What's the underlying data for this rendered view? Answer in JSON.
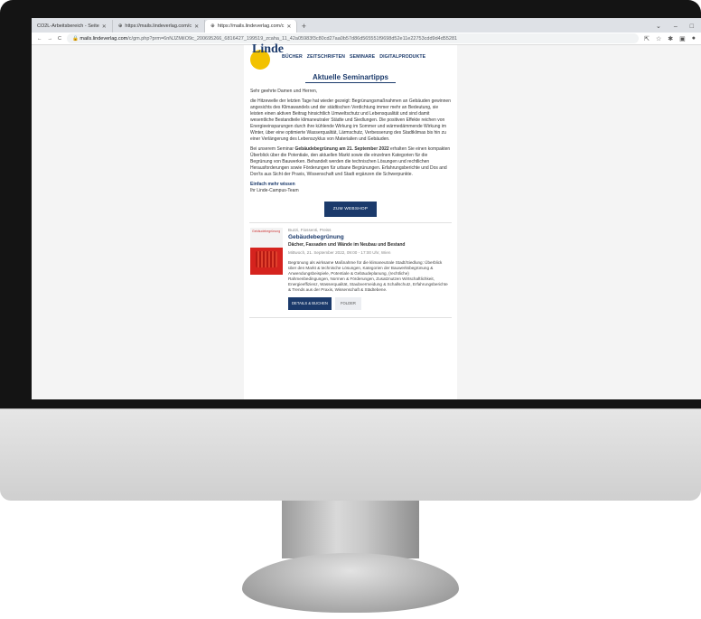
{
  "browser": {
    "tabs": [
      {
        "label": "CO2L-Arbeitsbereich - Seite",
        "active": false
      },
      {
        "label": "https://mails.lindeverlag.com/c",
        "active": false
      },
      {
        "label": "https://mails.lindeverlag.com/c",
        "active": true
      }
    ],
    "url_host": "mails.lindeverlag.com",
    "url_rest": "/c/gm.php?prm=6nNJZMiIO9c_200695266_6816427_199519_zcaha_11_42a05983f3c80cd27aa0b57d86d565551f9698d52e11e22753cdd9d4d55281",
    "new_tab": "+",
    "tab_close": "✕"
  },
  "email": {
    "logo": "Linde",
    "nav": [
      "BÜCHER",
      "ZEITSCHRIFTEN",
      "SEMINARE",
      "DIGITALPRODUKTE"
    ],
    "headline": "Aktuelle Seminartipps",
    "greeting": "Sehr geehrte Damen und Herren,",
    "para1": "die Hitzewelle der letzten Tage hat wieder gezeigt: Begrünungsmaßnahmen an Gebäuden gewinnen angesichts des Klimawandels und der städtischen Verdichtung immer mehr an Bedeutung, sie leisten einen aktiven Beitrag hinsichtlich Umweltschutz und Lebensqualität und sind damit wesentliche Bestandteile klimaneutraler Städte und Siedlungen. Die positiven Effekte reichen von Energieeinsparungen durch ihre kühlende Wirkung im Sommer und wärmedämmende Wirkung im Winter, über eine optimierte Wasserqualität, Lärmschutz, Verbesserung des Stadtklimas bis hin zu einer Verlängerung des Lebenszyklus von Materialien und Gebäuden.",
    "para2_pre": "Bei unserem Seminar ",
    "para2_bold1": "Gebäudebegrünung am 21. September 2022",
    "para2_post": " erhalten Sie einen kompakten Überblick über die Potentiale, den aktuellen Markt sowie die einzelnen Kategorien für die Begrünung von Bauwerken. Behandelt werden die technischen Lösungen und rechtlichen Herausforderungen sowie Förderungen für urbane Begrünungen. Erfahrungsberichte und Dos and Don'ts aus Sicht der Praxis, Wissenschaft und Stadt ergänzen die Schwerpunkte.",
    "sign_bold": "Einfach mehr wissen",
    "sign_team": "Ihr Linde-Campus-Team",
    "cta": "ZUM WEBSHOP",
    "event": {
      "authors": "Buzzi, Fiossenti, Preiss",
      "title": "Gebäudebegrünung",
      "subtitle": "Dächer, Fassaden und Wände im Neubau und Bestand",
      "date": "Mittwoch, 21. September 2022, 09:00 - 17:00 Uhr, Wien",
      "description": "Begrünung als wirksame Maßnahme für die klimaneutrale Stadt/Siedlung: Überblick über den Markt & technische Lösungen, Kategorien der Bauwerksbegrünung & Anwendungsbeispiele, Potentiale & Gebäudeplanung, (rechtliche) Rahmenbedingungen, Normen & Förderungen, Zusatznutzen Wirtschaftlichkeit, Energieeffizienz, Wasserqualität, Staubvermeidung & Schallschutz, Erfahrungsberichte & Trends aus der Praxis, Wissenschaft & Städtebene.",
      "btn_details": "DETAILS & BUCHEN",
      "btn_folder": "FOLDER",
      "cover_label": "Gebäudebegrünung"
    }
  },
  "colors": {
    "brand_blue": "#1b3a6b",
    "logo_yellow": "#f2c200",
    "cover_red": "#d5231e"
  }
}
